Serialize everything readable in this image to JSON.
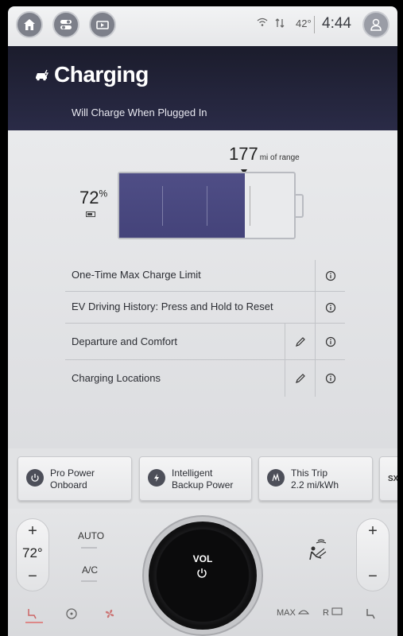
{
  "topbar": {
    "home_icon": "home-icon",
    "apps_icon": "apps-toggle-icon",
    "media_icon": "media-source-icon",
    "wifi_icon": "wifi-icon",
    "signal_icon": "data-transfer-icon",
    "temperature": "42°",
    "time": "4:44",
    "profile_icon": "profile-icon"
  },
  "header": {
    "title": "Charging",
    "subtitle": "Will Charge When Plugged In",
    "icon": "charging-car-icon"
  },
  "battery": {
    "percent": "72",
    "percent_unit": "%",
    "range_value": "177",
    "range_unit": "mi of range",
    "fill_fraction": 0.72
  },
  "settings": {
    "rows": [
      {
        "label": "One-Time Max Charge Limit",
        "edit": false
      },
      {
        "label": "EV Driving History:  Press and Hold to Reset",
        "edit": false
      },
      {
        "label": "Departure and Comfort",
        "edit": true
      },
      {
        "label": "Charging Locations",
        "edit": true
      }
    ]
  },
  "cards": [
    {
      "line1": "Pro Power",
      "line2": "Onboard",
      "icon": "pro-power-icon"
    },
    {
      "line1": "Intelligent",
      "line2": "Backup Power",
      "icon": "backup-power-icon"
    },
    {
      "line1": "This Trip",
      "line2": "2.2 mi/kWh",
      "icon": "trip-efficiency-icon"
    },
    {
      "line1": "SX",
      "line2": "",
      "icon": "sirius-icon"
    }
  ],
  "climate": {
    "left_temp": "72°",
    "plus": "+",
    "minus": "−",
    "auto_label": "AUTO",
    "ac_label": "A/C",
    "volume_label": "VOL",
    "max_defrost_label": "MAX",
    "rear_defrost_label": "R"
  },
  "colors": {
    "header_bg": "#1b1c2c",
    "battery_fill": "#4f4e86",
    "heat_indicator": "#d88888"
  }
}
